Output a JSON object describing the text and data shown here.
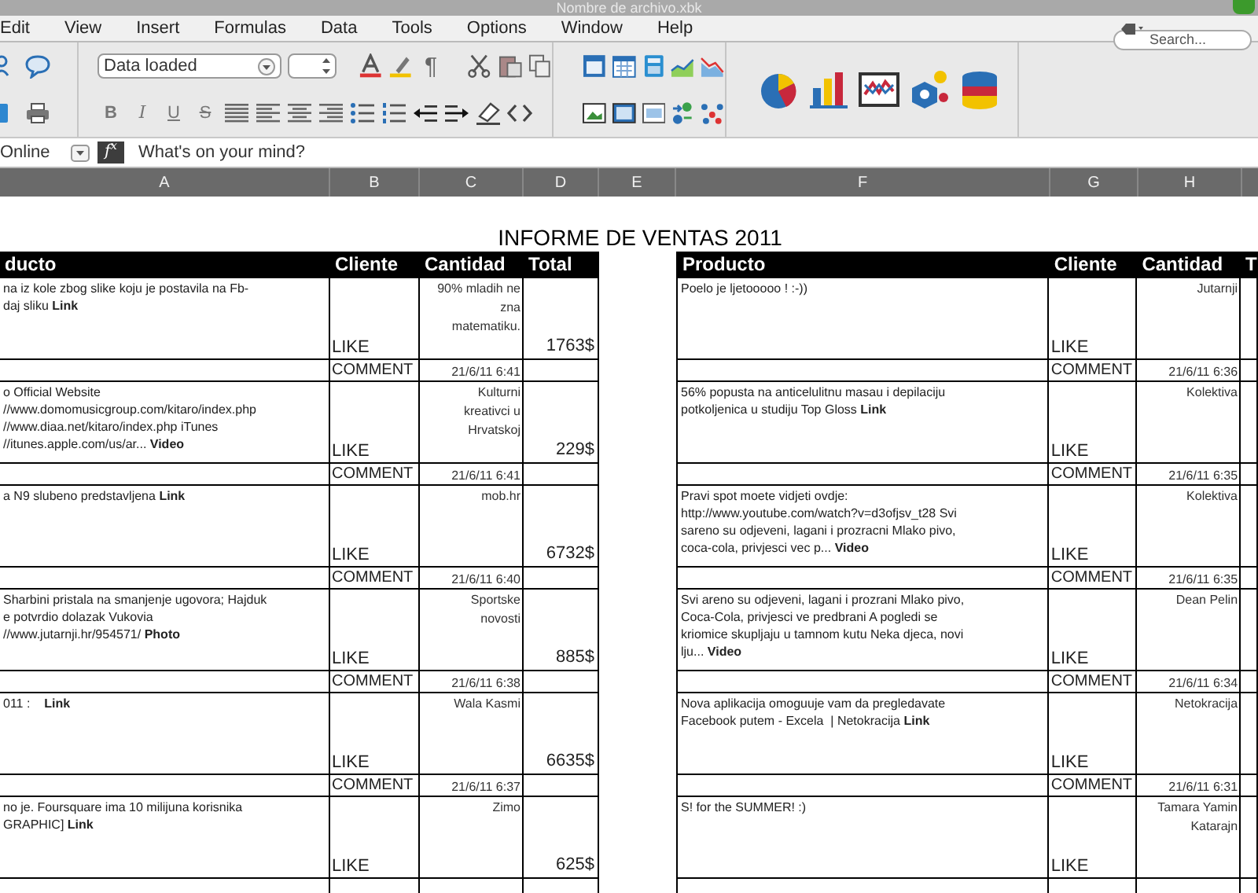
{
  "window": {
    "title": "Nombre de archivo.xbk"
  },
  "menu": [
    "Edit",
    "View",
    "Insert",
    "Formulas",
    "Data",
    "Tools",
    "Options",
    "Window",
    "Help"
  ],
  "search": {
    "placeholder": "Search..."
  },
  "toolbar": {
    "font": "Data loaded",
    "text_buttons": [
      "B",
      "I",
      "U",
      "S"
    ],
    "pilcrow": "¶"
  },
  "formula_bar": {
    "name_box": "Online",
    "function_label": "f$^{x}$",
    "formula": "What's on your mind?"
  },
  "columns": [
    "A",
    "B",
    "C",
    "D",
    "E",
    "F",
    "G",
    "H"
  ],
  "sheet": {
    "title": "INFORME DE VENTAS 2011",
    "left": {
      "headers": [
        "ducto",
        "Cliente",
        "Cantidad",
        "Total"
      ],
      "rows": [
        {
          "product": "na iz kole zbog slike koju je postavila na Fb-\ndaj sliku **Link**",
          "client": "LIKE",
          "source": "90% mladih ne\nzna\nmatematiku.",
          "total": "1763$",
          "comment": "COMMENT",
          "date": "21/6/11 6:41"
        },
        {
          "product": "o Official Website\n//www.domomusicgroup.com/kitaro/index.php\n//www.diaa.net/kitaro/index.php iTunes\n//itunes.apple.com/us/ar... **Video**",
          "client": "LIKE",
          "source": "Kulturni\nkreativci u\nHrvatskoj",
          "total": "229$",
          "comment": "COMMENT",
          "date": "21/6/11 6:41"
        },
        {
          "product": "a N9 slubeno predstavljena **Link**",
          "client": "LIKE",
          "source": "mob.hr",
          "total": "6732$",
          "comment": "COMMENT",
          "date": "21/6/11 6:40"
        },
        {
          "product": "Sharbini pristala na smanjenje ugovora; Hajduk\ne potvrdio dolazak Vukovia\n//www.jutarnji.hr/954571/ **Photo**",
          "client": "LIKE",
          "source": "Sportske\nnovosti",
          "total": "885$",
          "comment": "COMMENT",
          "date": "21/6/11 6:38"
        },
        {
          "product": "011 :    **Link**",
          "client": "LIKE",
          "source": "Wala Kasmi",
          "total": "6635$",
          "comment": "COMMENT",
          "date": "21/6/11 6:37"
        },
        {
          "product": "no je. Foursquare ima 10 milijuna korisnika\nGRAPHIC] **Link**",
          "client": "LIKE",
          "source": "Zimo",
          "total": "625$"
        }
      ]
    },
    "right": {
      "headers": [
        "Producto",
        "Cliente",
        "Cantidad",
        "T"
      ],
      "rows": [
        {
          "product": "Poelo je ljetooooo ! :-))",
          "client": "LIKE",
          "source": "Jutarnji",
          "comment": "COMMENT",
          "date": "21/6/11 6:36"
        },
        {
          "product": "56% popusta na anticelulitnu masau i depilaciju\npotkoljenica u studiju Top Gloss **Link**",
          "client": "LIKE",
          "source": "Kolektiva",
          "comment": "COMMENT",
          "date": "21/6/11 6:35"
        },
        {
          "product": "Pravi spot moete vidjeti ovdje:\nhttp://www.youtube.com/watch?v=d3ofjsv_t28 Svi\nsareno su odjeveni, lagani i prozracni Mlako pivo,\ncoca-cola, privjesci vec p... **Video**",
          "client": "LIKE",
          "source": "Kolektiva",
          "comment": "COMMENT",
          "date": "21/6/11 6:35"
        },
        {
          "product": "Svi areno su odjeveni, lagani i prozrani Mlako pivo,\nCoca-Cola, privjesci ve predbrani A pogledi se\nkriomice skupljaju u tamnom kutu Neka djeca, novi\nlju... **Video**",
          "client": "LIKE",
          "source": "Dean Pelin",
          "comment": "COMMENT",
          "date": "21/6/11 6:34"
        },
        {
          "product": "Nova aplikacija omoguuje vam da pregledavate\nFacebook putem - Excela  | Netokracija **Link**",
          "client": "LIKE",
          "source": "Netokracija",
          "comment": "COMMENT",
          "date": "21/6/11 6:31"
        },
        {
          "product": "S! for the SUMMER! :)",
          "client": "LIKE",
          "source": "Tamara Yamin\nKatarajn"
        }
      ]
    }
  }
}
